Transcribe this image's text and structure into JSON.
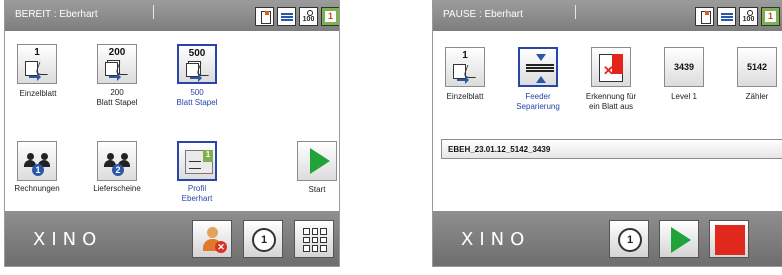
{
  "left": {
    "title": "BEREIT : Eberhart",
    "status_icons": [
      "document-icon",
      "feeder-icon",
      "counter-icon",
      "profile-icon"
    ],
    "counter_icon_text": "100",
    "tiles": [
      {
        "number": "1",
        "label": "Einzelblatt",
        "selected": false
      },
      {
        "number": "200",
        "label_lines": [
          "200",
          "Blatt Stapel"
        ],
        "selected": false
      },
      {
        "number": "500",
        "label_lines": [
          "500",
          "Blatt Stapel"
        ],
        "selected": true
      },
      {
        "badge": "1",
        "label": "Rechnungen",
        "selected": false
      },
      {
        "badge": "2",
        "label": "Lieferscheine",
        "selected": false
      },
      {
        "label_lines": [
          "Profil",
          "Eberhart"
        ],
        "selected": true
      }
    ],
    "start_label": "Start",
    "brand": "XINO",
    "bottom_buttons": [
      "user-remove-icon",
      "cycle-one-icon",
      "grid-menu-icon"
    ],
    "cycle_text": "1"
  },
  "right": {
    "title": "PAUSE : Eberhart",
    "status_icons": [
      "document-icon",
      "feeder-icon",
      "counter-icon",
      "profile-icon"
    ],
    "counter_icon_text": "100",
    "tiles": [
      {
        "number": "1",
        "label": "Einzelblatt",
        "selected": false
      },
      {
        "label_lines": [
          "Feeder",
          "Separierung"
        ],
        "selected": true
      },
      {
        "label_lines": [
          "Erkennung für",
          "ein Blatt aus"
        ],
        "selected": false
      },
      {
        "value": "3439",
        "label": "Level 1",
        "selected": false
      },
      {
        "value": "5142",
        "label": "Zähler",
        "selected": false
      }
    ],
    "field_value": "EBEH_23.01.12_5142_3439",
    "brand": "XINO",
    "bottom_buttons": [
      "cycle-one-icon",
      "play-icon",
      "stop-icon"
    ],
    "cycle_text": "1"
  },
  "colors": {
    "bar": "#8a8a8a",
    "selected_border": "#2845a8",
    "play_green": "#21a33a",
    "stop_red": "#e0291c"
  }
}
